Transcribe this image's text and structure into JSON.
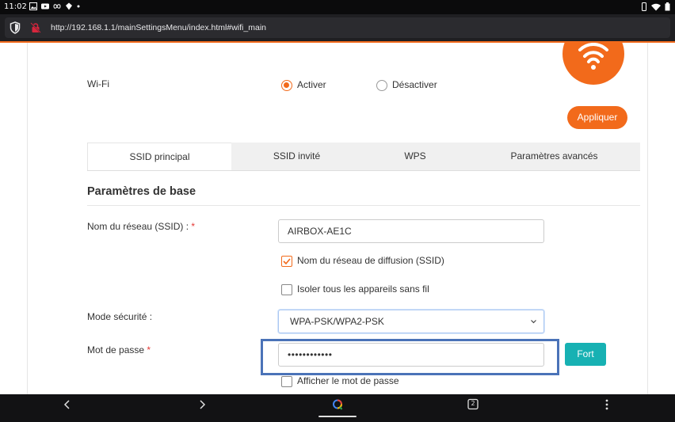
{
  "status_bar": {
    "time": "11:02",
    "icons": [
      "image-icon",
      "youtube-icon",
      "infinity-icon",
      "location-icon",
      "dot-icon"
    ],
    "right_icons": [
      "vibrate-icon",
      "wifi-signal-icon",
      "battery-icon"
    ]
  },
  "browser": {
    "url": "http://192.168.1.1/mainSettingsMenu/index.html#wifi_main"
  },
  "page": {
    "wifi_label": "Wi-Fi",
    "radio_on": "Activer",
    "radio_off": "Désactiver",
    "apply_button": "Appliquer",
    "tabs": [
      {
        "label": "SSID principal",
        "active": true
      },
      {
        "label": "SSID invité",
        "active": false
      },
      {
        "label": "WPS",
        "active": false
      },
      {
        "label": "Paramètres avancés",
        "active": false
      }
    ],
    "section_title": "Paramètres de base",
    "ssid_label": "Nom du réseau (SSID) :",
    "ssid_value": "AIRBOX-AE1C",
    "broadcast_checkbox": {
      "label": "Nom du réseau de diffusion (SSID)",
      "checked": true
    },
    "isolate_checkbox": {
      "label": "Isoler tous les appareils sans fil",
      "checked": false
    },
    "security_label": "Mode sécurité :",
    "security_value": "WPA-PSK/WPA2-PSK",
    "password_label": "Mot de passe",
    "required_mark": "*",
    "password_value": "••••••••••••",
    "strength_button": "Fort",
    "show_password_checkbox": {
      "label": "Afficher le mot de passe",
      "checked": false
    }
  },
  "nav_bar": {
    "tab_count": "2"
  },
  "colors": {
    "brand_orange": "#f26a1b",
    "strength_teal": "#17b1b3",
    "highlight_blue": "#4b73b8"
  }
}
